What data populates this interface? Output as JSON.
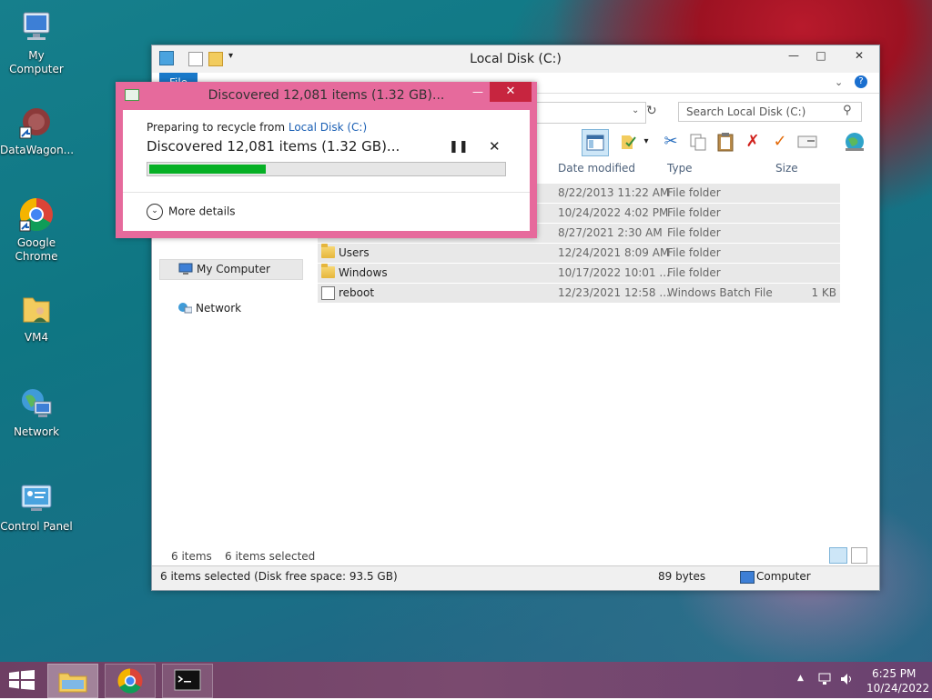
{
  "desktop": {
    "icons": [
      {
        "label": "My Computer"
      },
      {
        "label": "DataWagon..."
      },
      {
        "label": "Google Chrome"
      },
      {
        "label": "VM4"
      },
      {
        "label": "Network"
      },
      {
        "label": "Control Panel"
      }
    ]
  },
  "explorer": {
    "title": "Local Disk (C:)",
    "file_tab": "File",
    "search_placeholder": "Search Local Disk (C:)",
    "columns": [
      "Date modified",
      "Type",
      "Size"
    ],
    "rows": [
      {
        "name": "",
        "date": "8/22/2013 11:22 AM",
        "type": "File folder",
        "size": ""
      },
      {
        "name": "",
        "date": "10/24/2022 4:02 PM",
        "type": "File folder",
        "size": ""
      },
      {
        "name": "",
        "date": "8/27/2021 2:30 AM",
        "type": "File folder",
        "size": ""
      },
      {
        "name": "Users",
        "date": "12/24/2021 8:09 AM",
        "type": "File folder",
        "size": ""
      },
      {
        "name": "Windows",
        "date": "10/17/2022 10:01 ...",
        "type": "File folder",
        "size": ""
      },
      {
        "name": "reboot",
        "date": "12/23/2021 12:58 ...",
        "type": "Windows Batch File",
        "size": "1 KB"
      }
    ],
    "nav": [
      {
        "label": "My Computer"
      },
      {
        "label": "Network"
      }
    ],
    "status": {
      "items_count": "6 items",
      "items_selected": "6 items selected",
      "detail": "6 items selected (Disk free space: 93.5 GB)",
      "bytes": "89 bytes",
      "location": "Computer"
    }
  },
  "dialog": {
    "title": "Discovered 12,081 items (1.32 GB)...",
    "preparing_prefix": "Preparing to recycle from ",
    "preparing_link": "Local Disk (C:)",
    "headline": "Discovered 12,081 items (1.32 GB)...",
    "progress": 0.33,
    "more_details": "More details"
  },
  "taskbar": {
    "time": "6:25 PM",
    "date": "10/24/2022"
  }
}
